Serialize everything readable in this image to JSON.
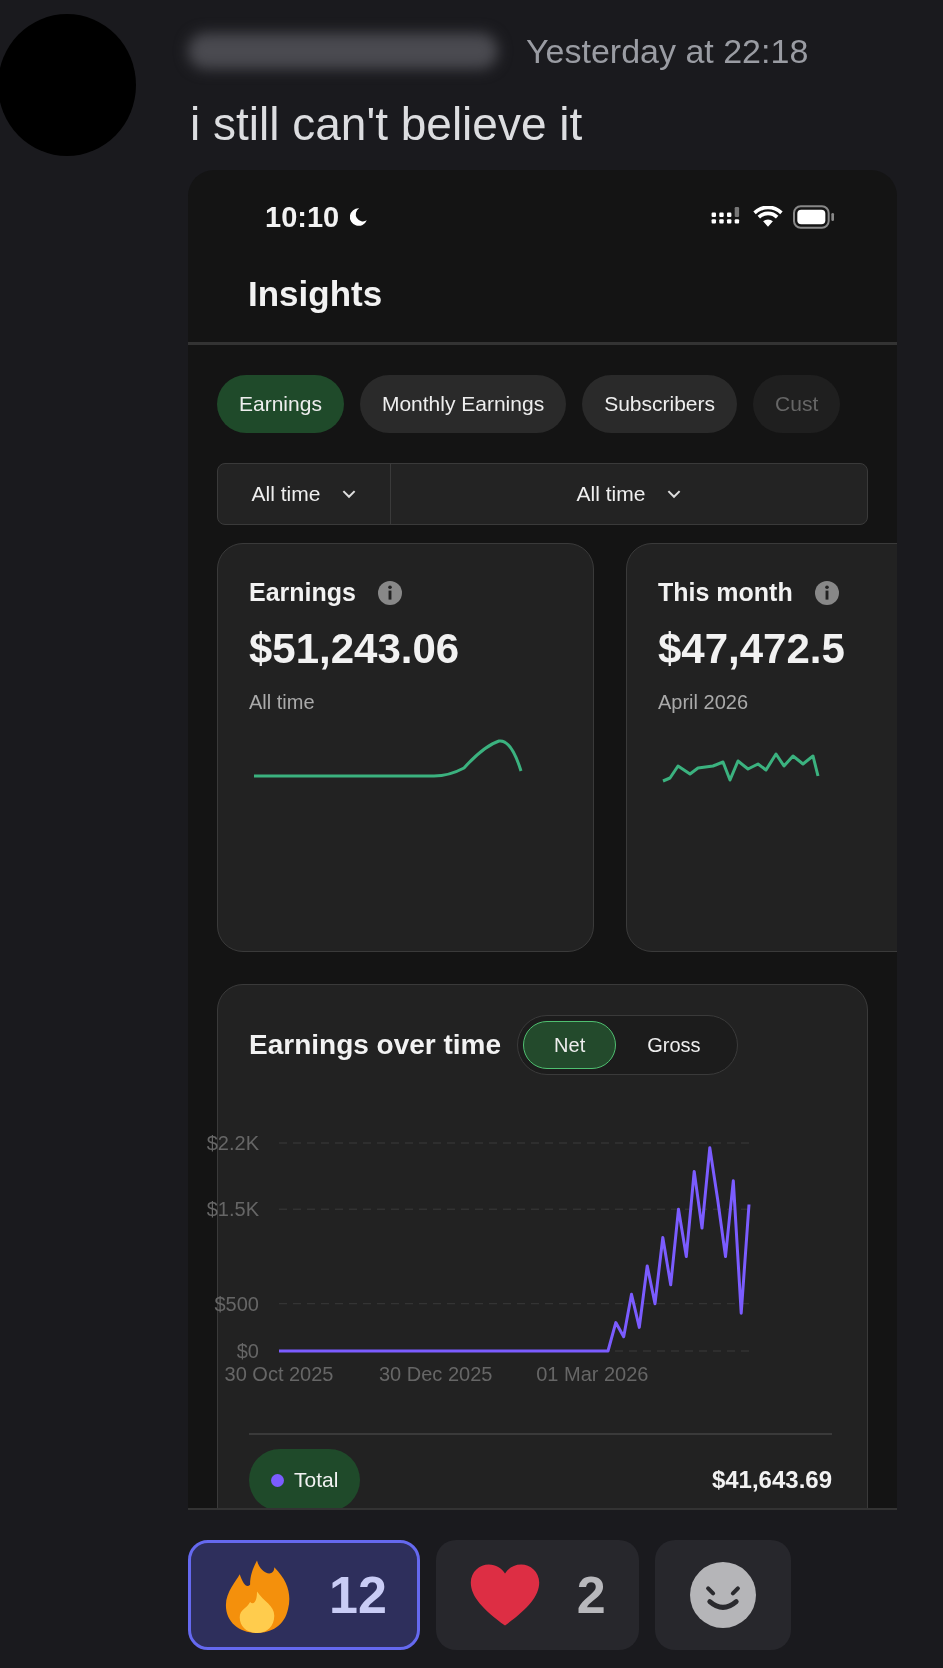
{
  "message": {
    "timestamp": "Yesterday at 22:18",
    "text": "i still can't believe it"
  },
  "phone": {
    "status_bar": {
      "time": "10:10"
    },
    "title": "Insights",
    "tabs": [
      {
        "label": "Earnings",
        "selected": true
      },
      {
        "label": "Monthly Earnings",
        "selected": false
      },
      {
        "label": "Subscribers",
        "selected": false
      },
      {
        "label": "Cust",
        "selected": false
      }
    ],
    "filters": [
      {
        "label": "All time"
      },
      {
        "label": "All time"
      }
    ],
    "stat_cards": [
      {
        "title": "Earnings",
        "value": "$51,243.06",
        "caption": "All time"
      },
      {
        "title": "This month",
        "value": "$47,472.5",
        "caption": "April 2026"
      }
    ],
    "earnings_chart": {
      "title": "Earnings over time",
      "toggle": [
        {
          "label": "Net",
          "selected": true
        },
        {
          "label": "Gross",
          "selected": false
        }
      ],
      "chart_data": {
        "type": "line",
        "categories": [
          "30 Oct 2025",
          null,
          null,
          null,
          null,
          null,
          null,
          null,
          null,
          null,
          null,
          null,
          null,
          null,
          null,
          null,
          null,
          null,
          null,
          null,
          "30 Dec 2025",
          null,
          null,
          null,
          null,
          null,
          null,
          null,
          null,
          null,
          null,
          null,
          null,
          null,
          null,
          null,
          null,
          null,
          null,
          null,
          "01 Mar 2026",
          null,
          null,
          null,
          null,
          null,
          null,
          null,
          null,
          null,
          null,
          null,
          null,
          null,
          null,
          null,
          null,
          null,
          null,
          null,
          null
        ],
        "series": [
          {
            "name": "Total",
            "color": "#7b5cff",
            "values": [
              0,
              0,
              0,
              0,
              0,
              0,
              0,
              0,
              0,
              0,
              0,
              0,
              0,
              0,
              0,
              0,
              0,
              0,
              0,
              0,
              0,
              0,
              0,
              0,
              0,
              0,
              0,
              0,
              0,
              0,
              0,
              0,
              0,
              0,
              0,
              0,
              0,
              0,
              0,
              0,
              0,
              0,
              0,
              300,
              150,
              600,
              250,
              900,
              500,
              1200,
              700,
              1500,
              1000,
              1900,
              1300,
              2150,
              1600,
              1000,
              1800,
              400,
              1550
            ]
          }
        ],
        "ylim": [
          0,
          2200
        ],
        "yticks": [
          {
            "value": 0,
            "label": "$0"
          },
          {
            "value": 500,
            "label": "$500"
          },
          {
            "value": 1500,
            "label": "$1.5K"
          },
          {
            "value": 2200,
            "label": "$2.2K"
          }
        ]
      },
      "legend_total": "$41,643.69"
    }
  },
  "reactions": [
    {
      "kind": "fire",
      "count": "12",
      "selected": true
    },
    {
      "kind": "heart",
      "count": "2",
      "selected": false
    },
    {
      "kind": "add"
    }
  ]
}
